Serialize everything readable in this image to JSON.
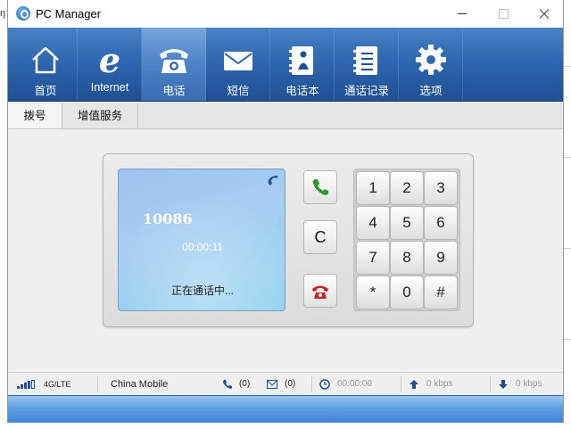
{
  "window": {
    "title": "PC Manager",
    "left_edge_text": "ŋ"
  },
  "toolbar": {
    "items": [
      {
        "label": "首页",
        "icon": "home-icon",
        "active": false
      },
      {
        "label": "Internet",
        "icon": "internet-icon",
        "active": false
      },
      {
        "label": "电话",
        "icon": "phone-icon",
        "active": true
      },
      {
        "label": "短信",
        "icon": "sms-icon",
        "active": false
      },
      {
        "label": "电话本",
        "icon": "phonebook-icon",
        "active": false
      },
      {
        "label": "通话记录",
        "icon": "call-log-icon",
        "active": false
      },
      {
        "label": "选项",
        "icon": "settings-gear-icon",
        "active": false
      }
    ]
  },
  "subtabs": [
    {
      "label": "拨号",
      "active": true
    },
    {
      "label": "增值服务",
      "active": false
    }
  ],
  "call": {
    "number": "10086",
    "timer": "00:00:11",
    "status": "正在通话中...",
    "clear_label": "C",
    "call_color": "#2a9a2a",
    "hangup_color": "#d02020"
  },
  "keypad": {
    "keys": [
      "1",
      "2",
      "3",
      "4",
      "5",
      "6",
      "7",
      "8",
      "9",
      "*",
      "0",
      "#"
    ]
  },
  "status": {
    "network_type": "4G/LTE",
    "operator": "China Mobile",
    "missed_calls": "(0)",
    "unread_sms": "(0)",
    "duration": "00:00:00",
    "upload": "0 kbps",
    "download": "0 kbps",
    "signal_bars": 4
  },
  "colors": {
    "toolbar_dark": "#1f4f94",
    "toolbar_light": "#4b82c6",
    "accent_blue": "#3f83d4"
  }
}
